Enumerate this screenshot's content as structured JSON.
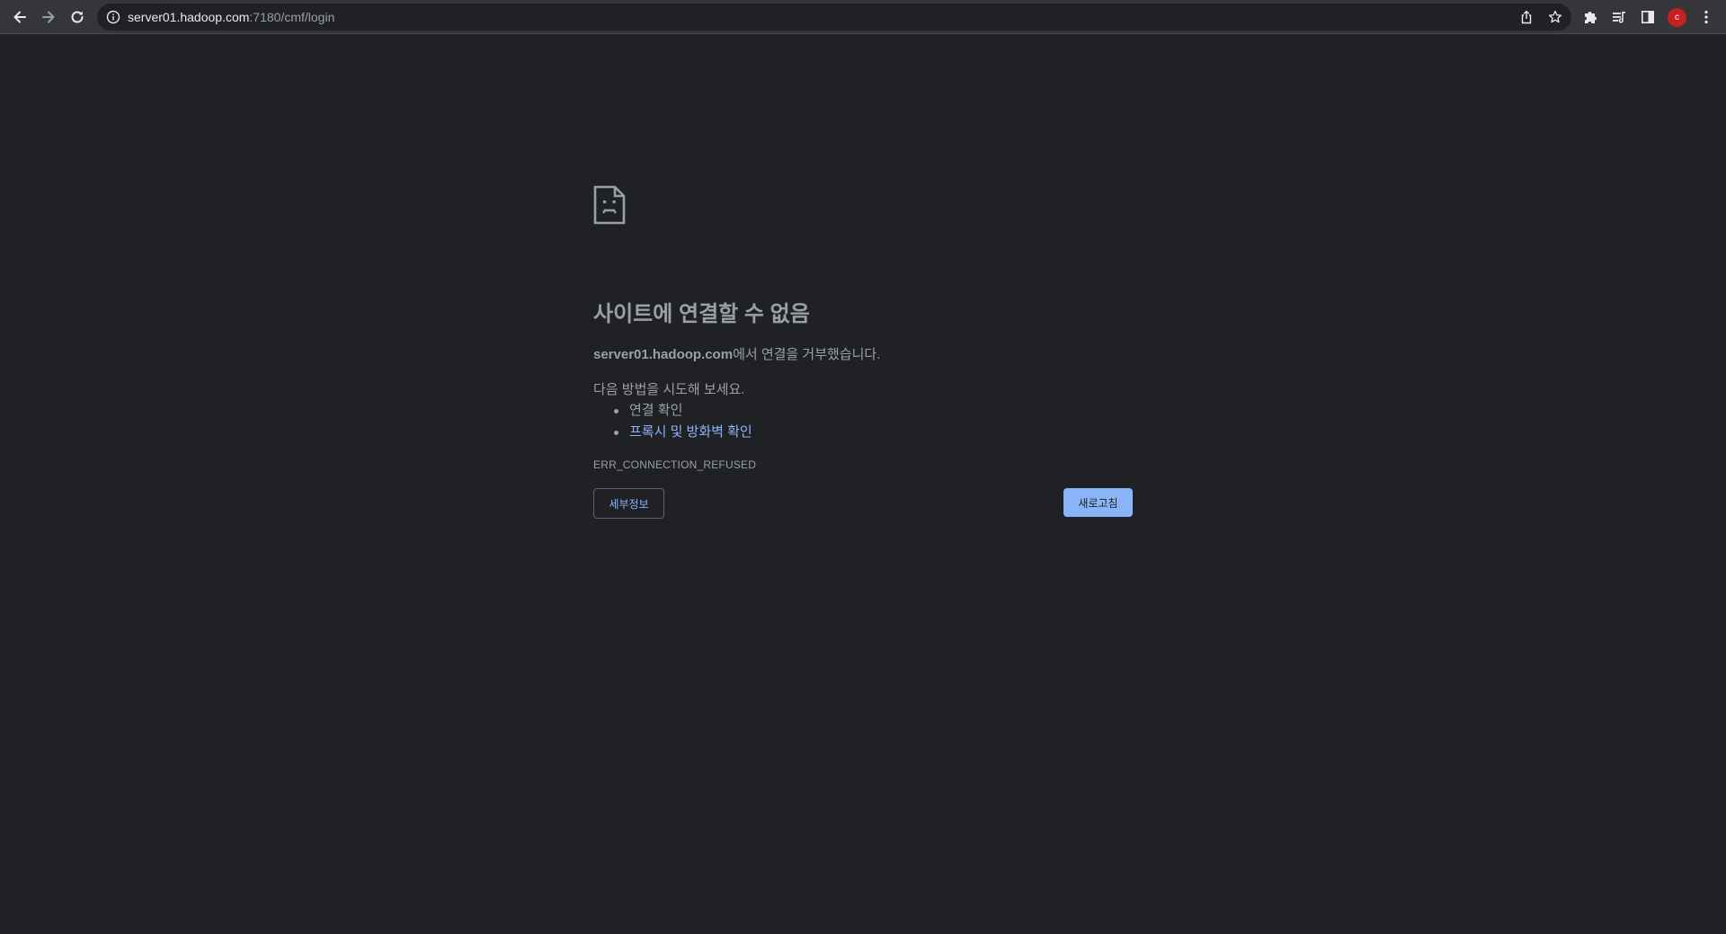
{
  "browser": {
    "url_host": "server01.hadoop.com",
    "url_path": ":7180/cmf/login",
    "profile_initial": "c"
  },
  "error_page": {
    "title": "사이트에 연결할 수 없음",
    "host": "server01.hadoop.com",
    "description_suffix": "에서 연결을 거부했습니다.",
    "suggestions_heading": "다음 방법을 시도해 보세요.",
    "suggestions": [
      {
        "label": "연결 확인",
        "link": false
      },
      {
        "label": "프록시 및 방화벽 확인",
        "link": true
      }
    ],
    "error_code": "ERR_CONNECTION_REFUSED",
    "details_button": "세부정보",
    "reload_button": "새로고침"
  },
  "colors": {
    "background": "#202124",
    "toolbar": "#35363a",
    "text_muted": "#9aa0a6",
    "link": "#8ab4f8",
    "avatar": "#c5221f"
  },
  "icons": {
    "back": "arrow-left-icon",
    "forward": "arrow-right-icon",
    "reload": "reload-icon",
    "site_info": "info-icon",
    "share": "share-icon",
    "bookmark": "star-icon",
    "extensions": "puzzle-icon",
    "reading_list": "reading-list-icon",
    "side_panel": "side-panel-icon",
    "menu": "kebab-menu-icon",
    "error": "sad-page-icon"
  }
}
